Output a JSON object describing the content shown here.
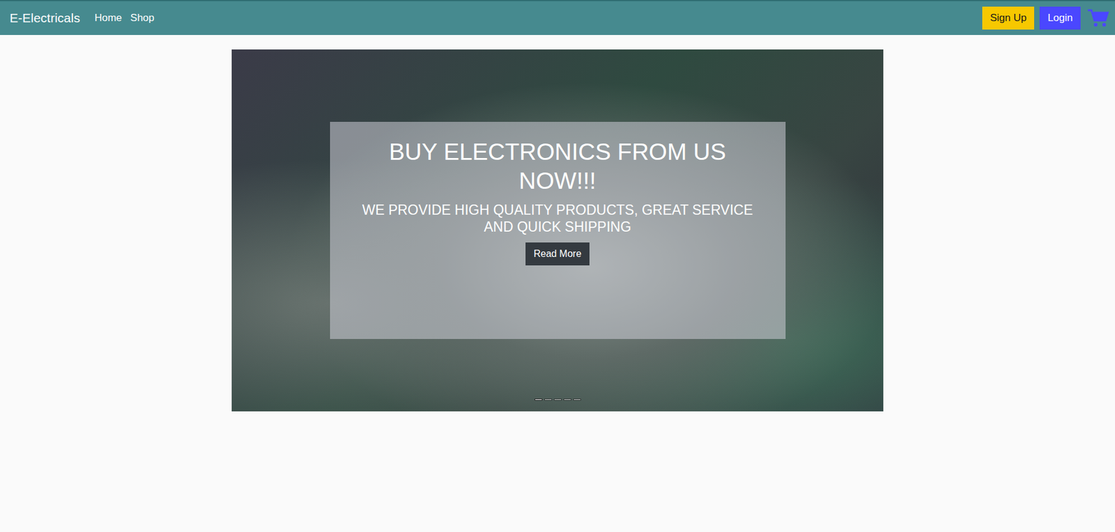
{
  "navbar": {
    "brand": "E-Electricals",
    "links": [
      "Home",
      "Shop"
    ],
    "buttons": [
      {
        "label": "Sign Up",
        "kind": "signup"
      },
      {
        "label": "Login",
        "kind": "login"
      }
    ],
    "cart": {
      "label": "cart"
    }
  },
  "carousel": {
    "caption": {
      "title": "BUY ELECTRONICS FROM US NOW!!!",
      "subtitle": "WE PROVIDE HIGH QUALITY PRODUCTS, GREAT SERVICE AND QUICK SHIPPING",
      "button": "Read More"
    },
    "indicators": [
      {
        "selected": true
      },
      {
        "selected": false
      },
      {
        "selected": false
      },
      {
        "selected": false
      },
      {
        "selected": false
      }
    ]
  }
}
